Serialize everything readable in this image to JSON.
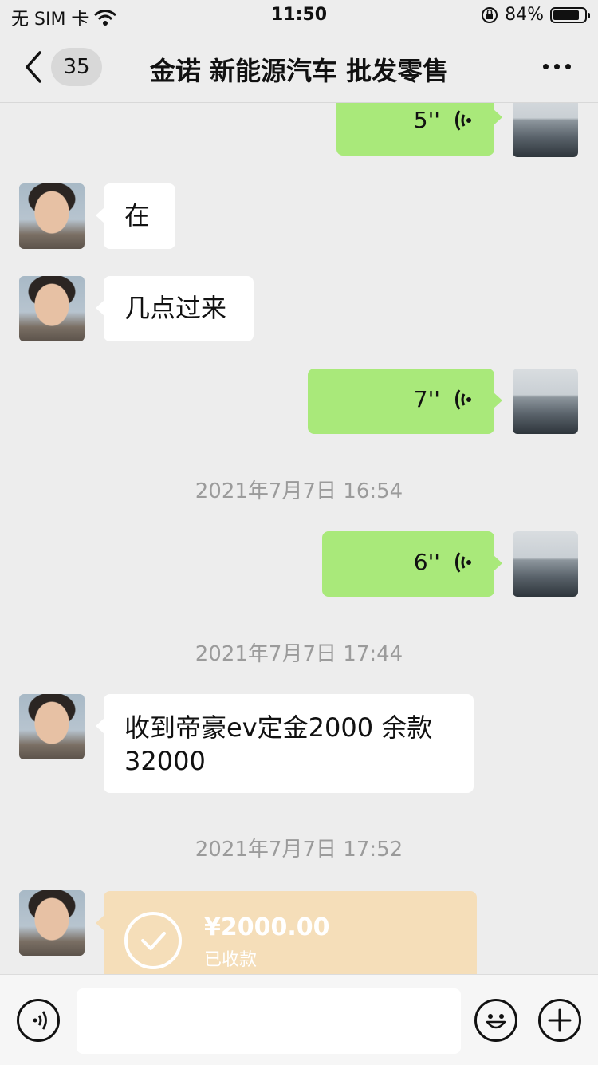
{
  "status_bar": {
    "carrier": "无 SIM 卡",
    "time": "11:50",
    "battery_percent": "84%",
    "battery_level": 0.84
  },
  "nav": {
    "unread_count": "35",
    "title": "金诺 新能源汽车 批发零售"
  },
  "messages": [
    {
      "type": "voice",
      "side": "right",
      "duration": "5''"
    },
    {
      "type": "text",
      "side": "left",
      "text": "在"
    },
    {
      "type": "text",
      "side": "left",
      "text": "几点过来"
    },
    {
      "type": "voice",
      "side": "right",
      "duration": "7''"
    },
    {
      "type": "time",
      "text": "2021年7月7日 16:54"
    },
    {
      "type": "voice",
      "side": "right",
      "duration": "6''"
    },
    {
      "type": "time",
      "text": "2021年7月7日 17:44"
    },
    {
      "type": "text",
      "side": "left",
      "text": "收到帝豪ev定金2000 余款32000"
    },
    {
      "type": "time",
      "text": "2021年7月7日 17:52"
    },
    {
      "type": "transfer",
      "side": "left",
      "amount": "¥2000.00",
      "status": "已收款"
    }
  ],
  "icons": {
    "back": "chevron-left-icon",
    "more": "more-dots-icon",
    "voice_wave": "voice-wave-icon",
    "voice_input": "voice-input-icon",
    "emoji": "emoji-icon",
    "plus": "plus-icon",
    "check": "check-icon"
  },
  "colors": {
    "background": "#ededed",
    "green_bubble": "#a9e97a",
    "transfer_bubble": "#f5deb9",
    "timestamp": "#9b9b9b"
  }
}
